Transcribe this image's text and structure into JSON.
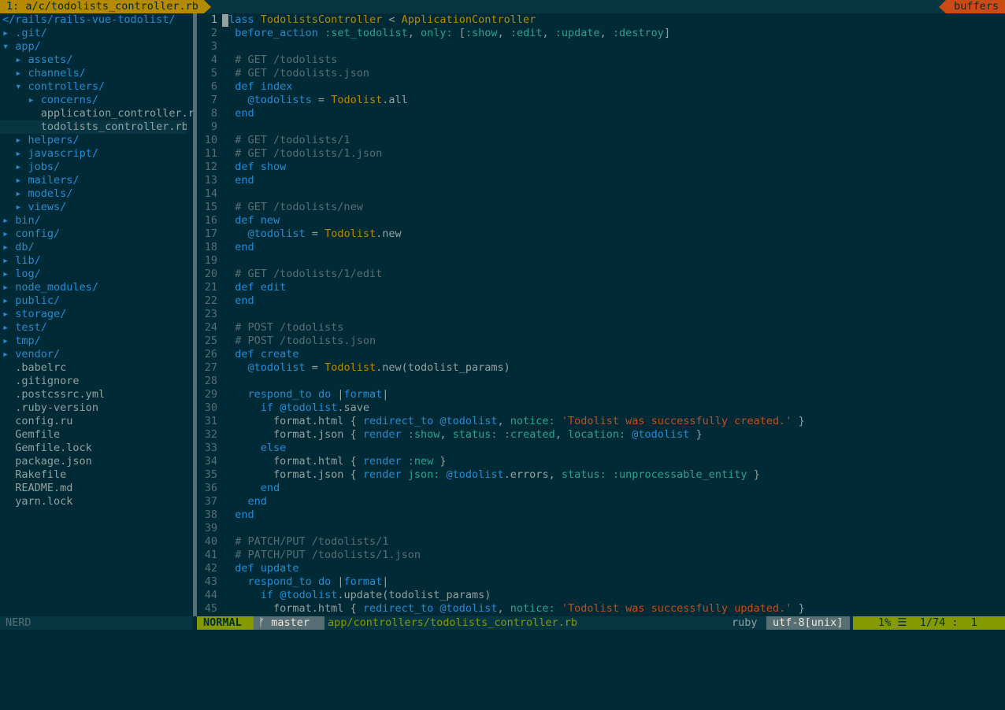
{
  "tabline": {
    "active_tab": "1: a/c/todolists_controller.rb",
    "buffers_label": "buffers"
  },
  "nerdtree": {
    "root": "</rails/rails-vue-todolist/",
    "status": "NERD",
    "items": [
      {
        "indent": 0,
        "arrow": "▸",
        "name": ".git/",
        "type": "dir"
      },
      {
        "indent": 0,
        "arrow": "▾",
        "name": "app/",
        "type": "dir"
      },
      {
        "indent": 1,
        "arrow": "▸",
        "name": "assets/",
        "type": "dir"
      },
      {
        "indent": 1,
        "arrow": "▸",
        "name": "channels/",
        "type": "dir"
      },
      {
        "indent": 1,
        "arrow": "▾",
        "name": "controllers/",
        "type": "dir"
      },
      {
        "indent": 2,
        "arrow": "▸",
        "name": "concerns/",
        "type": "dir"
      },
      {
        "indent": 2,
        "arrow": " ",
        "name": "application_controller.rb",
        "type": "file"
      },
      {
        "indent": 2,
        "arrow": " ",
        "name": "todolists_controller.rb",
        "type": "file",
        "selected": true
      },
      {
        "indent": 1,
        "arrow": "▸",
        "name": "helpers/",
        "type": "dir"
      },
      {
        "indent": 1,
        "arrow": "▸",
        "name": "javascript/",
        "type": "dir"
      },
      {
        "indent": 1,
        "arrow": "▸",
        "name": "jobs/",
        "type": "dir"
      },
      {
        "indent": 1,
        "arrow": "▸",
        "name": "mailers/",
        "type": "dir"
      },
      {
        "indent": 1,
        "arrow": "▸",
        "name": "models/",
        "type": "dir"
      },
      {
        "indent": 1,
        "arrow": "▸",
        "name": "views/",
        "type": "dir"
      },
      {
        "indent": 0,
        "arrow": "▸",
        "name": "bin/",
        "type": "dir"
      },
      {
        "indent": 0,
        "arrow": "▸",
        "name": "config/",
        "type": "dir"
      },
      {
        "indent": 0,
        "arrow": "▸",
        "name": "db/",
        "type": "dir"
      },
      {
        "indent": 0,
        "arrow": "▸",
        "name": "lib/",
        "type": "dir"
      },
      {
        "indent": 0,
        "arrow": "▸",
        "name": "log/",
        "type": "dir"
      },
      {
        "indent": 0,
        "arrow": "▸",
        "name": "node_modules/",
        "type": "dir"
      },
      {
        "indent": 0,
        "arrow": "▸",
        "name": "public/",
        "type": "dir"
      },
      {
        "indent": 0,
        "arrow": "▸",
        "name": "storage/",
        "type": "dir"
      },
      {
        "indent": 0,
        "arrow": "▸",
        "name": "test/",
        "type": "dir"
      },
      {
        "indent": 0,
        "arrow": "▸",
        "name": "tmp/",
        "type": "dir"
      },
      {
        "indent": 0,
        "arrow": "▸",
        "name": "vendor/",
        "type": "dir"
      },
      {
        "indent": 0,
        "arrow": " ",
        "name": ".babelrc",
        "type": "file"
      },
      {
        "indent": 0,
        "arrow": " ",
        "name": ".gitignore",
        "type": "file"
      },
      {
        "indent": 0,
        "arrow": " ",
        "name": ".postcssrc.yml",
        "type": "file"
      },
      {
        "indent": 0,
        "arrow": " ",
        "name": ".ruby-version",
        "type": "file"
      },
      {
        "indent": 0,
        "arrow": " ",
        "name": "config.ru",
        "type": "file"
      },
      {
        "indent": 0,
        "arrow": " ",
        "name": "Gemfile",
        "type": "file"
      },
      {
        "indent": 0,
        "arrow": " ",
        "name": "Gemfile.lock",
        "type": "file"
      },
      {
        "indent": 0,
        "arrow": " ",
        "name": "package.json",
        "type": "file"
      },
      {
        "indent": 0,
        "arrow": " ",
        "name": "Rakefile",
        "type": "file"
      },
      {
        "indent": 0,
        "arrow": " ",
        "name": "README.md",
        "type": "file"
      },
      {
        "indent": 0,
        "arrow": " ",
        "name": "yarn.lock",
        "type": "file"
      }
    ]
  },
  "editor": {
    "lines": [
      [
        [
          "class",
          "kw"
        ],
        [
          " "
        ],
        [
          "TodolistsController",
          "cls"
        ],
        [
          " < "
        ],
        [
          "ApplicationController",
          "cls"
        ]
      ],
      [
        [
          "  "
        ],
        [
          "before_action",
          "mth"
        ],
        [
          " "
        ],
        [
          ":set_todolist",
          "sym"
        ],
        [
          ", "
        ],
        [
          "only:",
          "sym"
        ],
        [
          " ["
        ],
        [
          ":show",
          "sym"
        ],
        [
          ", "
        ],
        [
          ":edit",
          "sym"
        ],
        [
          ", "
        ],
        [
          ":update",
          "sym"
        ],
        [
          ", "
        ],
        [
          ":destroy",
          "sym"
        ],
        [
          "]"
        ]
      ],
      [],
      [
        [
          "  "
        ],
        [
          "# GET /todolists",
          "cmt"
        ]
      ],
      [
        [
          "  "
        ],
        [
          "# GET /todolists.json",
          "cmt"
        ]
      ],
      [
        [
          "  "
        ],
        [
          "def",
          "kw"
        ],
        [
          " "
        ],
        [
          "index",
          "mth"
        ]
      ],
      [
        [
          "    "
        ],
        [
          "@todolists",
          "ivar"
        ],
        [
          " = "
        ],
        [
          "Todolist",
          "cls"
        ],
        [
          ".all"
        ]
      ],
      [
        [
          "  "
        ],
        [
          "end",
          "kw"
        ]
      ],
      [],
      [
        [
          "  "
        ],
        [
          "# GET /todolists/1",
          "cmt"
        ]
      ],
      [
        [
          "  "
        ],
        [
          "# GET /todolists/1.json",
          "cmt"
        ]
      ],
      [
        [
          "  "
        ],
        [
          "def",
          "kw"
        ],
        [
          " "
        ],
        [
          "show",
          "mth"
        ]
      ],
      [
        [
          "  "
        ],
        [
          "end",
          "kw"
        ]
      ],
      [],
      [
        [
          "  "
        ],
        [
          "# GET /todolists/new",
          "cmt"
        ]
      ],
      [
        [
          "  "
        ],
        [
          "def",
          "kw"
        ],
        [
          " "
        ],
        [
          "new",
          "mth"
        ]
      ],
      [
        [
          "    "
        ],
        [
          "@todolist",
          "ivar"
        ],
        [
          " = "
        ],
        [
          "Todolist",
          "cls"
        ],
        [
          ".new"
        ]
      ],
      [
        [
          "  "
        ],
        [
          "end",
          "kw"
        ]
      ],
      [],
      [
        [
          "  "
        ],
        [
          "# GET /todolists/1/edit",
          "cmt"
        ]
      ],
      [
        [
          "  "
        ],
        [
          "def",
          "kw"
        ],
        [
          " "
        ],
        [
          "edit",
          "mth"
        ]
      ],
      [
        [
          "  "
        ],
        [
          "end",
          "kw"
        ]
      ],
      [],
      [
        [
          "  "
        ],
        [
          "# POST /todolists",
          "cmt"
        ]
      ],
      [
        [
          "  "
        ],
        [
          "# POST /todolists.json",
          "cmt"
        ]
      ],
      [
        [
          "  "
        ],
        [
          "def",
          "kw"
        ],
        [
          " "
        ],
        [
          "create",
          "mth"
        ]
      ],
      [
        [
          "    "
        ],
        [
          "@todolist",
          "ivar"
        ],
        [
          " = "
        ],
        [
          "Todolist",
          "cls"
        ],
        [
          ".new(todolist_params)"
        ]
      ],
      [],
      [
        [
          "    "
        ],
        [
          "respond_to",
          "mth"
        ],
        [
          " "
        ],
        [
          "do",
          "kw"
        ],
        [
          " |"
        ],
        [
          "format",
          "mth"
        ],
        [
          "|"
        ]
      ],
      [
        [
          "      "
        ],
        [
          "if",
          "kw"
        ],
        [
          " "
        ],
        [
          "@todolist",
          "ivar"
        ],
        [
          ".save"
        ]
      ],
      [
        [
          "        format.html { "
        ],
        [
          "redirect_to",
          "mth"
        ],
        [
          " "
        ],
        [
          "@todolist",
          "ivar"
        ],
        [
          ", "
        ],
        [
          "notice:",
          "sym"
        ],
        [
          " "
        ],
        [
          "'Todolist was successfully created.'",
          "str"
        ],
        [
          " }"
        ]
      ],
      [
        [
          "        format.json { "
        ],
        [
          "render",
          "mth"
        ],
        [
          " "
        ],
        [
          ":show",
          "sym"
        ],
        [
          ", "
        ],
        [
          "status:",
          "sym"
        ],
        [
          " "
        ],
        [
          ":created",
          "sym"
        ],
        [
          ", "
        ],
        [
          "location:",
          "sym"
        ],
        [
          " "
        ],
        [
          "@todolist",
          "ivar"
        ],
        [
          " }"
        ]
      ],
      [
        [
          "      "
        ],
        [
          "else",
          "kw"
        ]
      ],
      [
        [
          "        format.html { "
        ],
        [
          "render",
          "mth"
        ],
        [
          " "
        ],
        [
          ":new",
          "sym"
        ],
        [
          " }"
        ]
      ],
      [
        [
          "        format.json { "
        ],
        [
          "render",
          "mth"
        ],
        [
          " "
        ],
        [
          "json:",
          "sym"
        ],
        [
          " "
        ],
        [
          "@todolist",
          "ivar"
        ],
        [
          ".errors, "
        ],
        [
          "status:",
          "sym"
        ],
        [
          " "
        ],
        [
          ":unprocessable_entity",
          "sym"
        ],
        [
          " }"
        ]
      ],
      [
        [
          "      "
        ],
        [
          "end",
          "kw"
        ]
      ],
      [
        [
          "    "
        ],
        [
          "end",
          "kw"
        ]
      ],
      [
        [
          "  "
        ],
        [
          "end",
          "kw"
        ]
      ],
      [],
      [
        [
          "  "
        ],
        [
          "# PATCH/PUT /todolists/1",
          "cmt"
        ]
      ],
      [
        [
          "  "
        ],
        [
          "# PATCH/PUT /todolists/1.json",
          "cmt"
        ]
      ],
      [
        [
          "  "
        ],
        [
          "def",
          "kw"
        ],
        [
          " "
        ],
        [
          "update",
          "mth"
        ]
      ],
      [
        [
          "    "
        ],
        [
          "respond_to",
          "mth"
        ],
        [
          " "
        ],
        [
          "do",
          "kw"
        ],
        [
          " |"
        ],
        [
          "format",
          "mth"
        ],
        [
          "|"
        ]
      ],
      [
        [
          "      "
        ],
        [
          "if",
          "kw"
        ],
        [
          " "
        ],
        [
          "@todolist",
          "ivar"
        ],
        [
          ".update(todolist_params)"
        ]
      ],
      [
        [
          "        format.html { "
        ],
        [
          "redirect_to",
          "mth"
        ],
        [
          " "
        ],
        [
          "@todolist",
          "ivar"
        ],
        [
          ", "
        ],
        [
          "notice:",
          "sym"
        ],
        [
          " "
        ],
        [
          "'Todolist was successfully updated.'",
          "str"
        ],
        [
          " }"
        ]
      ]
    ]
  },
  "statusline": {
    "mode": "NORMAL",
    "branch": "ᚠ master",
    "filepath": "app/controllers/todolists_controller.rb",
    "filetype": "ruby",
    "encoding": "utf-8[unix]",
    "percent": "1%",
    "position": "1/74",
    "column": "1",
    "position_text": "1% ☰  1/74 :  1"
  },
  "colors": {
    "background": "#002b36",
    "accent_yellow": "#b58900",
    "accent_orange": "#cb4b16",
    "accent_green": "#859900",
    "keyword_blue": "#268bd2",
    "symbol_cyan": "#2aa198"
  }
}
